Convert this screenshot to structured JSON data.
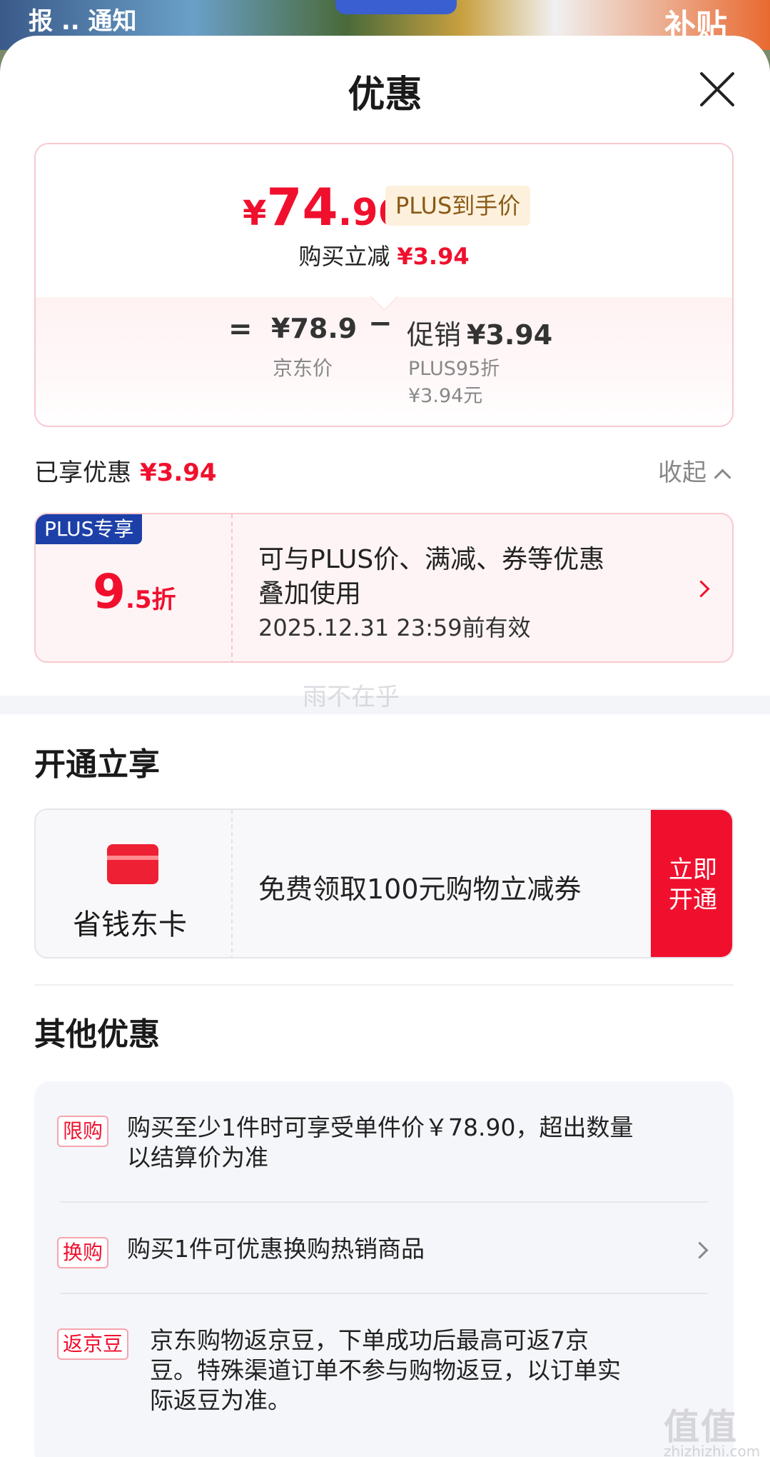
{
  "background": {
    "banner_left": "报 .. 通知",
    "banner_right": "补贴"
  },
  "sheet": {
    "title": "优惠"
  },
  "price_card": {
    "final_yen": "¥",
    "final_int": "74",
    "final_dec": ".96",
    "plus_tag": "PLUS到手价",
    "sub_text": "购买立减",
    "sub_amount": "¥3.94",
    "equals": "=",
    "jd_price": "¥78.9",
    "jd_price_label": "京东价",
    "minus": "−",
    "promo_label": "促销",
    "promo_amount": "¥3.94",
    "promo_sub1": "PLUS95折",
    "promo_sub2": "¥3.94元"
  },
  "enjoyed": {
    "label": "已享优惠",
    "amount": "¥3.94",
    "collapse": "收起"
  },
  "coupon": {
    "tag": "PLUS专享",
    "discount_int": "9",
    "discount_rest": ".5折",
    "line1": "可与PLUS价、满减、券等优惠",
    "line2": "叠加使用",
    "valid": "2025.12.31 23:59前有效"
  },
  "watermark": "雨不在乎",
  "membership": {
    "title": "开通立享",
    "card_name": "省钱东卡",
    "desc": "免费领取100元购物立减券",
    "button_line1": "立即",
    "button_line2": "开通"
  },
  "other": {
    "title": "其他优惠",
    "items": [
      {
        "tag": "限购",
        "line1": "购买至少1件时可享受单件价￥78.90，超出数量",
        "line2": "以结算价为准"
      },
      {
        "tag": "换购",
        "line1": "购买1件可优惠换购热销商品"
      },
      {
        "tag": "返京豆",
        "line1": "京东购物返京豆，下单成功后最高可返7京",
        "line2": "豆。特殊渠道订单不参与购物返豆，以订单实",
        "line3": "际返豆为准。"
      }
    ]
  },
  "site_watermark": {
    "mark": "值值值",
    "url": "zhizhizhi.com"
  },
  "colors": {
    "accent": "#f0102e",
    "plus_blue": "#1d3fa8",
    "plus_gold_bg": "#fdf1dd"
  }
}
